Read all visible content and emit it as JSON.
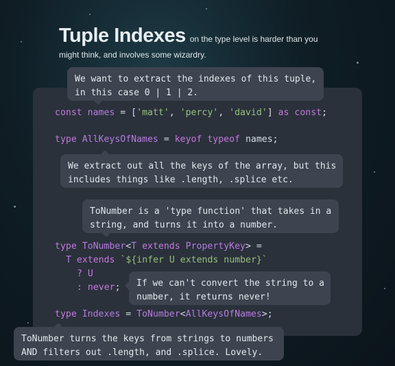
{
  "header": {
    "title": "Tuple Indexes",
    "subtitle_part1": "on the type level is harder than you",
    "subtitle_part2": "might think, and involves some wizardry."
  },
  "code": {
    "line1": {
      "kw1": "const",
      "id": "names",
      "eq": " = [",
      "s1": "'matt'",
      "c1": ", ",
      "s2": "'percy'",
      "c2": ", ",
      "s3": "'david'",
      "end": "] ",
      "kw2": "as const",
      "semi": ";"
    },
    "line2": {
      "kw1": "type",
      "id": "AllKeysOfNames",
      "eq": " = ",
      "kw2": "keyof",
      "kw3": "typeof",
      "rest": " names;"
    },
    "line3": {
      "kw1": "type",
      "id": "ToNumber",
      "lt": "<",
      "t": "T",
      "ext": "extends",
      "pk": "PropertyKey",
      "gt": "> ="
    },
    "line4": {
      "t": "T",
      "ext": "extends",
      "tpl": "`${infer U extends number}`"
    },
    "line5": {
      "q": "? U"
    },
    "line6": {
      "colon": ": ",
      "never": "never",
      "semi": ";"
    },
    "line7": {
      "kw1": "type",
      "id": "Indexes",
      "eq": " = ",
      "fn": "ToNumber",
      "lt": "<",
      "arg": "AllKeysOfNames",
      "gt": ">",
      "semi": ";"
    }
  },
  "notes": {
    "n1": "We want to extract the indexes of this tuple,\nin this case 0 | 1 | 2.",
    "n2": "We extract out all the keys of the array, but this\nincludes things like .length, .splice etc.",
    "n3": "ToNumber is a 'type function' that takes in a\nstring, and turns it into a number.",
    "n4": "If we can't convert the string to a\nnumber, it returns never!",
    "n5": "ToNumber turns the keys from strings to numbers\nAND filters out .length, and .splice. Lovely."
  },
  "colors": {
    "background": "#0f1d25",
    "panel": "#2a313b",
    "note": "#3d4450",
    "keyword": "#c678dd",
    "string": "#98c07a"
  }
}
